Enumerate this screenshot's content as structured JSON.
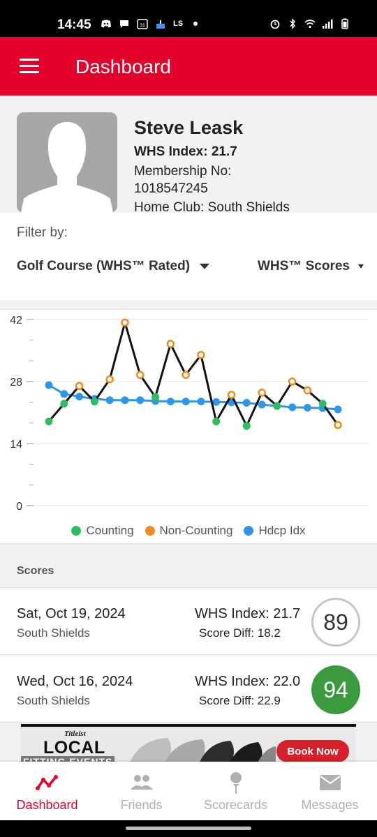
{
  "status_bar": {
    "time": "14:45",
    "carrier_tag": "LS"
  },
  "app_bar": {
    "title": "Dashboard"
  },
  "profile": {
    "name": "Steve Leask",
    "whs_index": "WHS Index: 21.7",
    "membership_label": "Membership No:",
    "membership_no": "1018547245",
    "home_club": "Home Club: South Shields"
  },
  "filter": {
    "label": "Filter by:",
    "course": "Golf Course (WHS™ Rated)",
    "scores": "WHS™ Scores"
  },
  "chart_data": {
    "type": "line",
    "ylim": [
      0,
      42
    ],
    "yticks": [
      0,
      14,
      28,
      42
    ],
    "grid": true,
    "legend_position": "bottom",
    "legend": [
      "Counting",
      "Non-Counting",
      "Hdcp Idx"
    ],
    "colors": {
      "counting": "#2dbe60",
      "non_counting": "#f08a1c",
      "hdcp": "#2f96e8",
      "line": "#111111"
    },
    "series": [
      {
        "name": "Scores",
        "values": [
          19.0,
          23.0,
          27.0,
          23.5,
          28.5,
          41.3,
          29.5,
          24.5,
          36.5,
          29.5,
          34.0,
          19.0,
          25.0,
          18.0,
          25.5,
          22.5,
          28.0,
          26.0,
          23.0,
          18.2
        ],
        "kinds": [
          "counting",
          "counting",
          "non",
          "counting",
          "non",
          "non",
          "non",
          "counting",
          "non",
          "non",
          "non",
          "counting",
          "non",
          "counting",
          "non",
          "counting",
          "non",
          "non",
          "counting",
          "non"
        ]
      },
      {
        "name": "Hdcp Idx",
        "values": [
          27.2,
          25.2,
          24.6,
          24.1,
          23.8,
          23.8,
          23.8,
          23.6,
          23.5,
          23.5,
          23.5,
          23.4,
          23.3,
          23.2,
          22.8,
          22.5,
          22.2,
          22.1,
          22.0,
          21.7
        ]
      }
    ]
  },
  "scores": {
    "title": "Scores",
    "rows": [
      {
        "date": "Sat, Oct 19, 2024",
        "course": "South Shields",
        "whs": "WHS Index: 21.7",
        "diff": "Score Diff: 18.2",
        "score": "89",
        "style": "outline"
      },
      {
        "date": "Wed, Oct 16, 2024",
        "course": "South Shields",
        "whs": "WHS Index: 22.0",
        "diff": "Score Diff: 22.9",
        "score": "94",
        "style": "green"
      }
    ]
  },
  "ad": {
    "brand": "Titleist",
    "headline": "LOCAL",
    "subline": "FITTING EVENTS",
    "cta": "Book Now"
  },
  "bottom_nav": {
    "items": [
      {
        "label": "Dashboard",
        "icon": "trend-line-icon",
        "active": true
      },
      {
        "label": "Friends",
        "icon": "people-icon",
        "active": false
      },
      {
        "label": "Scorecards",
        "icon": "golf-tee-icon",
        "active": false
      },
      {
        "label": "Messages",
        "icon": "envelope-icon",
        "active": false
      }
    ]
  }
}
